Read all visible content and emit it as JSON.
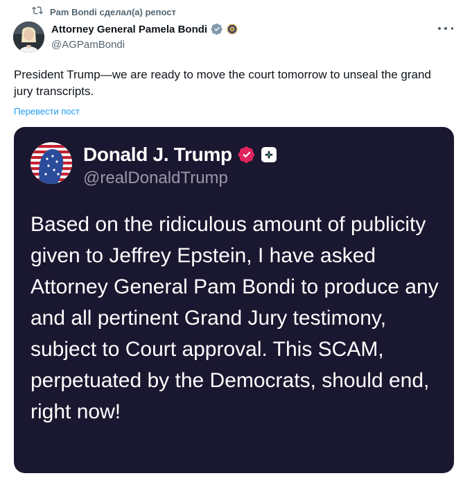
{
  "repost": {
    "icon": "repost-icon",
    "text": "Pam Bondi сделал(а) репост"
  },
  "post": {
    "author_name": "Attorney General Pamela Bondi",
    "handle": "@AGPamBondi",
    "verified_icon": "government-verified-badge",
    "affiliation_icon": "doj-seal-icon",
    "text": "President Trump—we are ready to move the court tomorrow to unseal the grand jury transcripts.",
    "translate_label": "Перевести пост",
    "more_icon": "more-icon"
  },
  "embedded": {
    "name": "Donald J. Trump",
    "handle": "@realDonaldTrump",
    "body": "Based on the ridiculous amount of publicity given to Jeffrey Epstein, I have asked Attorney General Pam Bondi to produce any and all pertinent Grand Jury testimony, subject to Court approval. This SCAM, perpetuated by the Democrats, should end, right now!",
    "verified_icon": "verified-badge-pink",
    "plus_icon": "plus-icon",
    "background_color": "#1a1730"
  },
  "colors": {
    "accent": "#1d9bf0",
    "secondary_text": "#536471",
    "verified_pink": "#e0245e"
  }
}
